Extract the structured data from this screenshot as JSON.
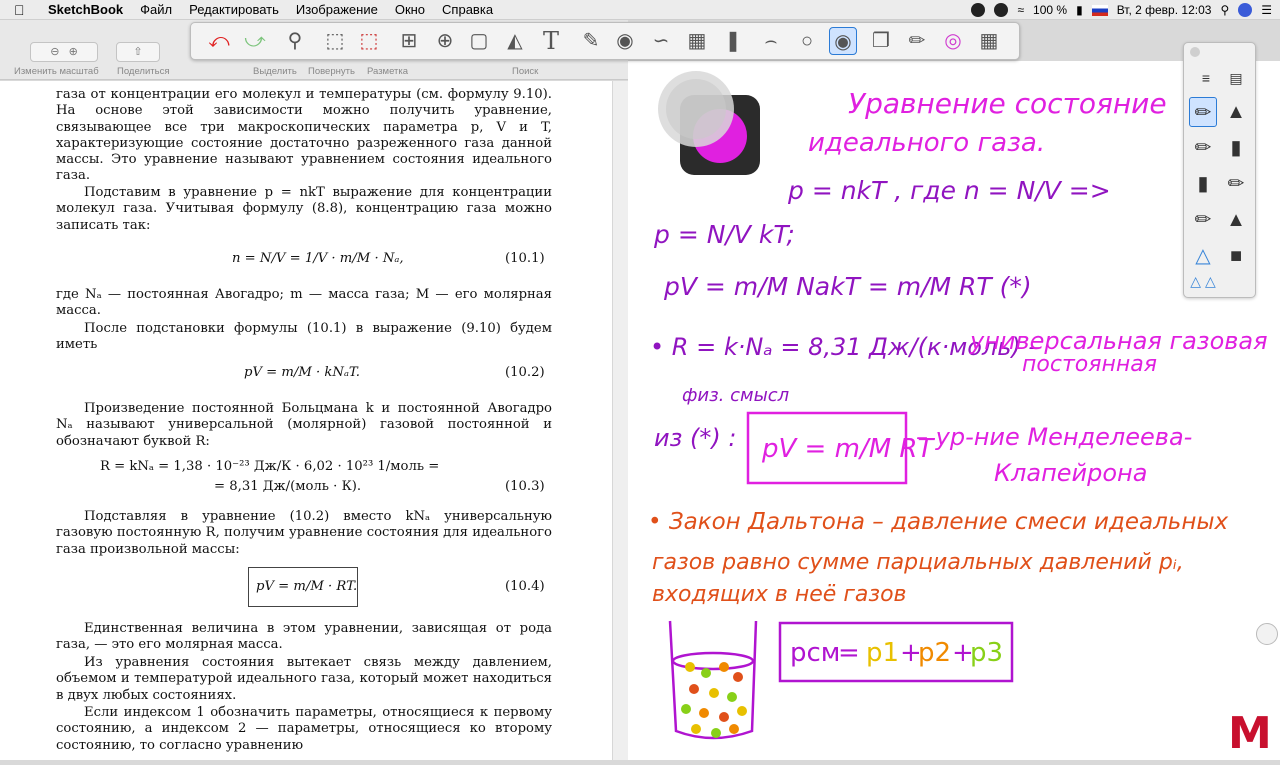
{
  "menubar": {
    "app_name": "SketchBook",
    "items": [
      "Файл",
      "Редактировать",
      "Изображение",
      "Окно",
      "Справка"
    ],
    "battery": "100 %",
    "datetime": "Вт, 2 февр.  12:03"
  },
  "preview_toolbar": {
    "zoom_label": "Изменить масштаб",
    "share_label": "Поделиться",
    "highlight_label": "Выделить",
    "rotate_label": "Повернуть",
    "markup_label": "Разметка",
    "search_label": "Поиск"
  },
  "document": {
    "p1": "газа от концентрации его молекул и температуры (см. формулу 9.10). На основе этой зависимости можно получить уравнение, связывающее все три макроскопических параметра p, V и T, характеризующие состояние достаточно разреженного газа данной массы. Это уравнение называют уравнением состояния идеального газа.",
    "p2": "Подставим в уравнение p = nkT выражение для концентрации молекул газа. Учитывая формулу (8.8), концентрацию газа можно записать так:",
    "eq1": "n = N/V = 1/V · m/M · Nₐ,",
    "eq1_num": "(10.1)",
    "p3": "где Nₐ — постоянная Авогадро; m — масса газа; M — его молярная масса.",
    "p4": "После подстановки формулы (10.1) в выражение (9.10) будем иметь",
    "eq2": "pV = m/M · kNₐT.",
    "eq2_num": "(10.2)",
    "p5": "Произведение постоянной Больцмана k и постоянной Авогадро Nₐ называют универсальной (молярной) газовой постоянной и обозначают буквой R:",
    "eq3a": "R = kNₐ = 1,38 · 10⁻²³ Дж/К · 6,02 · 10²³ 1/моль =",
    "eq3b": "= 8,31 Дж/(моль · К).",
    "eq3_num": "(10.3)",
    "p6": "Подставляя в уравнение (10.2) вместо kNₐ универсальную газовую постоянную R, получим уравнение состояния для идеального газа произвольной массы:",
    "eq4": "pV = m/M · RT.",
    "eq4_num": "(10.4)",
    "p7": "Единственная величина в этом уравнении, зависящая от рода газа, — это его молярная масса.",
    "p8": "Из уравнения состояния вытекает связь между давлением, объемом и температурой идеального газа, который может находиться в двух любых состояниях.",
    "p9": "Если индексом 1 обозначить параметры, относящиеся к первому состоянию, а индексом 2 — параметры, относящиеся ко второму состоянию, то согласно уравнению"
  },
  "notes": {
    "title1": "Уравнение состояние",
    "title2": "идеального газа.",
    "l1": "p = nkT , где n = N/V =>",
    "l2": "p = N/V kT;",
    "l3": "pV = m/M NakT = m/M RT  (*)",
    "l4a": "• R = k·Nₐ = 8,31 Дж/(к·моль) –",
    "l4b": "универсальная газовая",
    "l4c": "постоянная",
    "l5": "физ. смысл",
    "l6a": "из (*) :",
    "l6box": "pV = m/M RT",
    "l6b": "– ур-ние Менделеева-",
    "l6c": "Клапейрона",
    "l7a": "• Закон Дальтона – давление смеси идеальных",
    "l7b": "газов равно сумме парциальных давлений pᵢ,",
    "l7c": "входящих в неё газов",
    "formula_psm": "pсм",
    "formula_eq": "=",
    "formula_p1": "p1",
    "formula_plus1": "+",
    "formula_p2": "p2",
    "formula_plus2": "+",
    "formula_p3": "p3"
  },
  "colors": {
    "purple": "#b014d0",
    "magenta": "#e020e0",
    "red": "#e0501a",
    "yellow": "#e8c000",
    "orange": "#f08a00",
    "green": "#88d018"
  },
  "icons": [
    "undo-icon",
    "redo-icon",
    "zoom-icon",
    "select-rect-icon",
    "select-lasso-icon",
    "crop-icon",
    "transform-icon",
    "distort-icon",
    "fill-icon",
    "text-icon",
    "ruler-icon",
    "ellipse-guide-icon",
    "french-curve-icon",
    "perspective-icon",
    "symmetry-icon",
    "stroke-icon",
    "circle-icon",
    "layer-icon",
    "copy-icon",
    "brushes-icon",
    "color-wheel-icon",
    "grid-icon"
  ]
}
